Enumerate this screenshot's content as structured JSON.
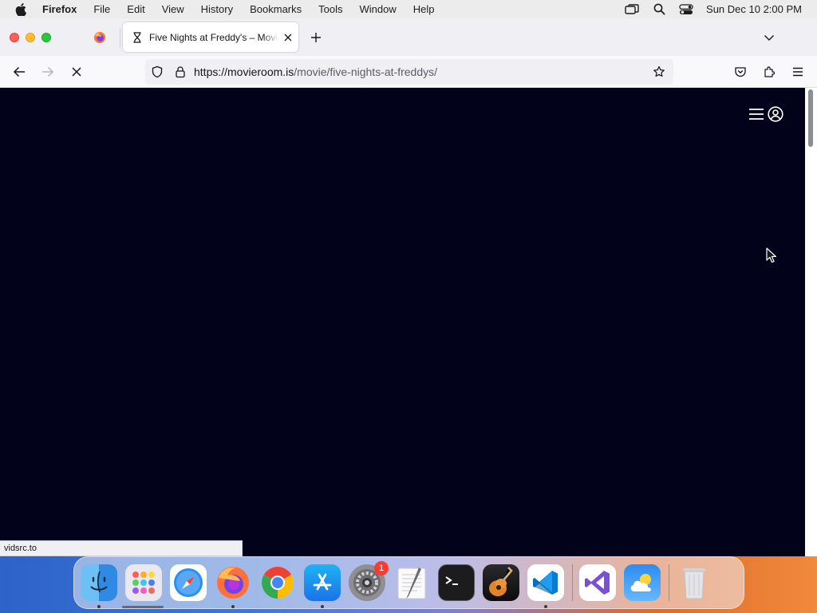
{
  "menubar": {
    "apple_icon": "apple-logo-icon",
    "app_name": "Firefox",
    "items": [
      "File",
      "Edit",
      "View",
      "History",
      "Bookmarks",
      "Tools",
      "Window",
      "Help"
    ],
    "status_icons": [
      "screen-mirroring-icon",
      "spotlight-search-icon",
      "control-center-icon"
    ],
    "clock": "Sun Dec 10  2:00 PM"
  },
  "browser": {
    "pinned_tab_icon": "firefox-icon",
    "active_tab": {
      "title": "Five Nights at Freddy's – Movie",
      "favicon": "hourglass-loading-icon"
    },
    "url": {
      "host": "https://movieroom.is",
      "path": "/movie/five-nights-at-freddys/"
    },
    "status_text": "vidsrc.to"
  },
  "page": {
    "background_color": "#02021a",
    "menu_icon": "hamburger-menu-icon",
    "account_icon": "user-account-icon"
  },
  "dock": {
    "apps": [
      {
        "name": "Finder",
        "icon": "finder-icon",
        "running": true
      },
      {
        "name": "Launchpad",
        "icon": "launchpad-icon",
        "running": false
      },
      {
        "name": "Safari",
        "icon": "safari-icon",
        "running": false
      },
      {
        "name": "Firefox",
        "icon": "firefox-icon",
        "running": true
      },
      {
        "name": "Google Chrome",
        "icon": "chrome-icon",
        "running": false
      },
      {
        "name": "App Store",
        "icon": "app-store-icon",
        "running": true
      },
      {
        "name": "System Settings",
        "icon": "system-settings-icon",
        "running": false,
        "badge": "1"
      },
      {
        "name": "TextEdit",
        "icon": "textedit-icon",
        "running": false
      },
      {
        "name": "Terminal",
        "icon": "terminal-icon",
        "running": false
      },
      {
        "name": "GarageBand",
        "icon": "garageband-icon",
        "running": false
      },
      {
        "name": "Visual Studio Code",
        "icon": "vscode-icon",
        "running": true
      },
      {
        "name": "Visual Studio",
        "icon": "visual-studio-icon",
        "running": false
      },
      {
        "name": "Weather",
        "icon": "weather-icon",
        "running": false
      },
      {
        "name": "Trash",
        "icon": "trash-icon",
        "running": false
      }
    ]
  }
}
